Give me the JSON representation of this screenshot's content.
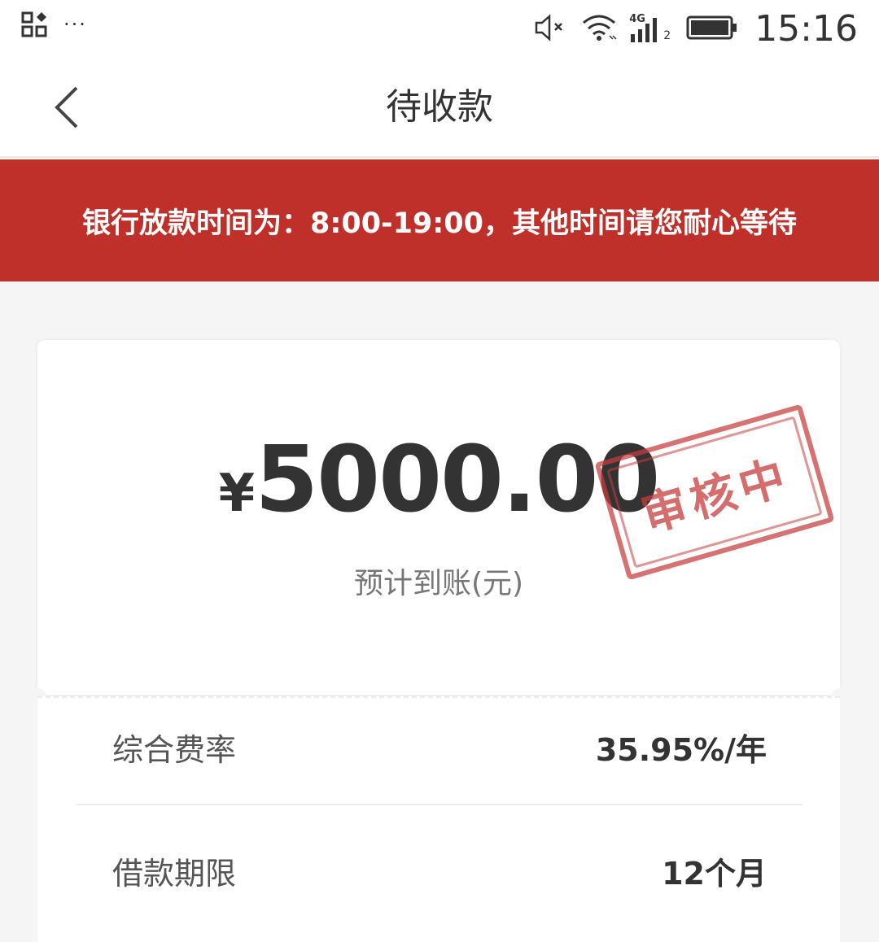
{
  "status_bar": {
    "time": "15:16",
    "network_label": "4G",
    "sim_index": "2",
    "overflow": "···",
    "icons": [
      "grid-icon",
      "mute-icon",
      "wifi-icon",
      "signal-icon",
      "battery-icon"
    ]
  },
  "nav": {
    "title": "待收款",
    "back_icon": "chevron-left-icon"
  },
  "notice": {
    "text": "银行放款时间为：8:00-19:00，其他时间请您耐心等待"
  },
  "amount_card": {
    "currency_symbol": "¥",
    "amount": "5000.00",
    "label": "预计到账(元)",
    "stamp_text": "审核中"
  },
  "details": [
    {
      "label": "综合费率",
      "value": "35.95%/年"
    },
    {
      "label": "借款期限",
      "value": "12个月"
    }
  ],
  "colors": {
    "banner": "#c0302b",
    "stamp": "#c83c3c",
    "background": "#f5f5f5"
  }
}
